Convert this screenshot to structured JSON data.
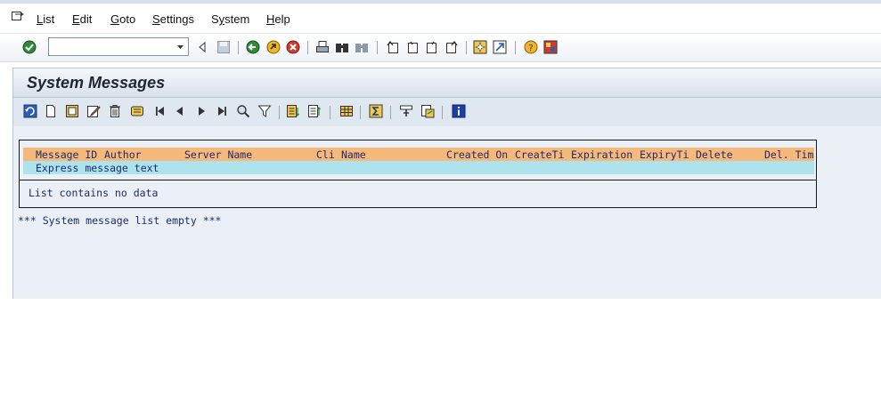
{
  "menu": {
    "items": [
      {
        "label": "List",
        "underline": "L",
        "rest": "ist"
      },
      {
        "label": "Edit",
        "underline": "E",
        "rest": "dit"
      },
      {
        "label": "Goto",
        "underline": "G",
        "rest": "oto"
      },
      {
        "label": "Settings",
        "underline": "S",
        "rest": "ettings"
      },
      {
        "label": "System",
        "underline": "y",
        "pre": "S",
        "rest": "stem"
      },
      {
        "label": "Help",
        "underline": "H",
        "rest": "elp"
      }
    ]
  },
  "command_field": {
    "value": ""
  },
  "screen": {
    "title": "System Messages"
  },
  "list": {
    "columns": [
      "Message ID",
      "Author",
      "Server Name",
      "Cli",
      "Name",
      "Created On",
      "CreateTi",
      "Expiration",
      "ExpiryTi",
      "Delete",
      "Del. Tim"
    ],
    "subheader": "Express message text",
    "no_data": "List contains no data"
  },
  "status_text": "*** System message list empty ***",
  "colors": {
    "header_row": "#f5b97c",
    "subheader_row": "#aee3ee",
    "list_text": "#1d2b6b",
    "background": "#eaf0f5"
  }
}
